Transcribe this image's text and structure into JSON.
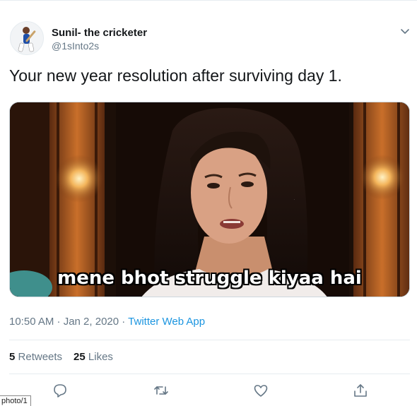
{
  "tweet": {
    "author_name": "Sunil- the cricketer",
    "author_handle": "@1sInto2s",
    "text": "Your new year resolution after surviving day 1.",
    "media_caption": "mene bhot struggle kiyaa hai",
    "timestamp": "10:50 AM · Jan 2, 2020",
    "separator": " · ",
    "source": "Twitter Web App",
    "retweets_count": "5",
    "retweets_label": "Retweets",
    "likes_count": "25",
    "likes_label": "Likes"
  },
  "status_bar": {
    "text": "photo/1"
  },
  "colors": {
    "link": "#1b95e0",
    "secondary_text": "#657786",
    "divider": "#e6ecf0",
    "primary_text": "#14171a"
  },
  "icons": {
    "caret": "chevron-down-icon",
    "reply": "reply-icon",
    "retweet": "retweet-icon",
    "like": "heart-icon",
    "share": "share-icon"
  }
}
